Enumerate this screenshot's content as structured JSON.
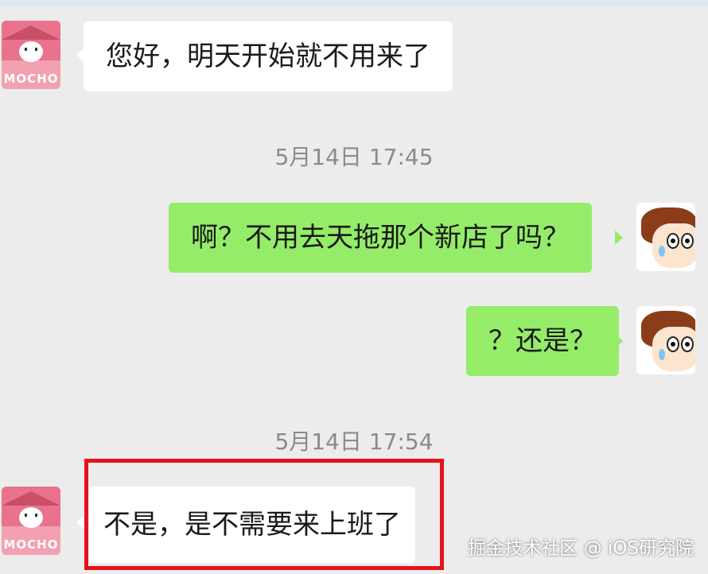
{
  "messages": [
    {
      "side": "left",
      "text": "您好，明天开始就不用来了"
    },
    {
      "side": "right",
      "text": "啊？不用去天拖那个新店了吗？"
    },
    {
      "side": "right",
      "text": "？还是？"
    },
    {
      "side": "left",
      "text": "不是，是不需要来上班了"
    }
  ],
  "timestamps": [
    "5月14日 17:45",
    "5月14日 17:54"
  ],
  "shop_avatar": {
    "label": "MOCHO"
  },
  "watermark": "掘金技术社区 @ iOS研究院",
  "colors": {
    "sent_bubble": "#95ec69",
    "received_bubble": "#ffffff",
    "highlight": "#e3131c",
    "background": "#ececec"
  }
}
